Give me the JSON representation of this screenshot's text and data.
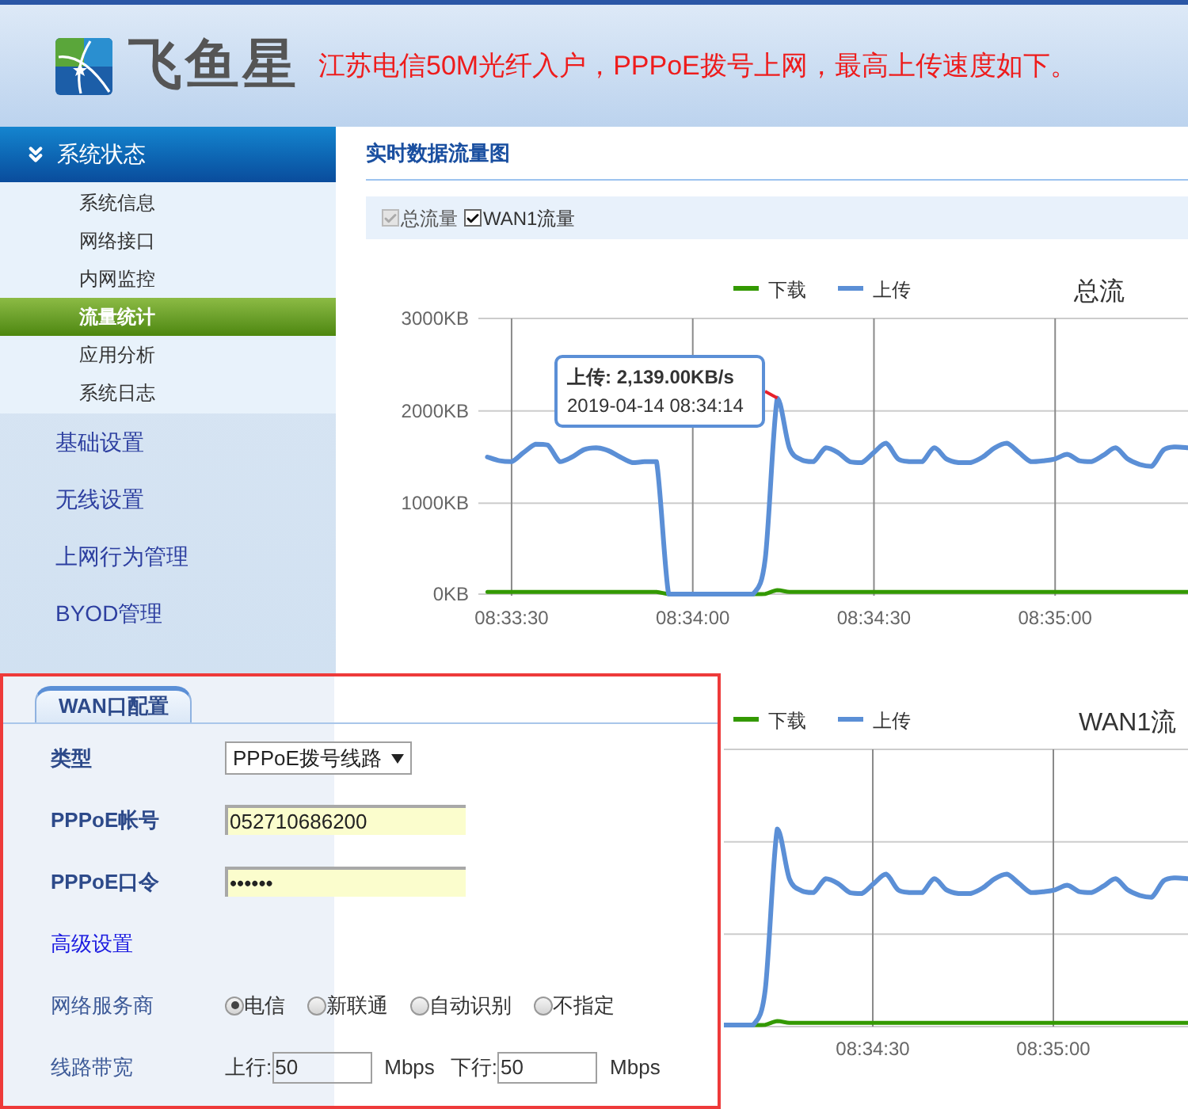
{
  "header": {
    "brand": "飞鱼星",
    "notice": "江苏电信50M光纤入户，PPPoE拨号上网，最高上传速度如下。"
  },
  "sidebar": {
    "sections": [
      {
        "label": "系统状态",
        "expanded": true,
        "children": [
          {
            "label": "系统信息",
            "selected": false
          },
          {
            "label": "网络接口",
            "selected": false
          },
          {
            "label": "内网监控",
            "selected": false
          },
          {
            "label": "流量统计",
            "selected": true
          },
          {
            "label": "应用分析",
            "selected": false
          },
          {
            "label": "系统日志",
            "selected": false
          }
        ]
      },
      {
        "label": "基础设置",
        "expanded": false
      },
      {
        "label": "无线设置",
        "expanded": false
      },
      {
        "label": "上网行为管理",
        "expanded": false
      },
      {
        "label": "BYOD管理",
        "expanded": false
      }
    ]
  },
  "main": {
    "title": "实时数据流量图",
    "filters": [
      {
        "label": "总流量",
        "checked": true,
        "disabled": true
      },
      {
        "label": "WAN1流量",
        "checked": true,
        "disabled": false
      }
    ],
    "charts": [
      {
        "title": "总流",
        "tooltip": {
          "value": "上传: 2,139.00KB/s",
          "time": "2019-04-14 08:34:14"
        },
        "chart_data": {
          "type": "line",
          "categories": [
            null,
            null,
            "08:33:30",
            null,
            null,
            null,
            null,
            null,
            null,
            null,
            null,
            null,
            null,
            null,
            null,
            null,
            null,
            "08:34:00",
            null,
            null,
            null,
            null,
            null,
            null,
            null,
            null,
            null,
            null,
            null,
            null,
            null,
            null,
            "08:34:30",
            null,
            null,
            null,
            null,
            null,
            null,
            null,
            null,
            null,
            null,
            null,
            null,
            null,
            null,
            "08:35:00",
            null,
            null,
            null,
            null,
            null,
            null,
            null,
            null,
            null,
            null,
            null
          ],
          "series": [
            {
              "name": "下载",
              "color": "#339900",
              "values": [
                40,
                40,
                40,
                40,
                40,
                40,
                40,
                40,
                40,
                40,
                40,
                40,
                40,
                40,
                40,
                0,
                0,
                0,
                0,
                0,
                0,
                0,
                0,
                20,
                60,
                40,
                40,
                40,
                40,
                40,
                40,
                40,
                40,
                40,
                40,
                40,
                40,
                40,
                40,
                40,
                40,
                40,
                40,
                40,
                40,
                40,
                40,
                40,
                40,
                40,
                40,
                40,
                40,
                40,
                40,
                40,
                40,
                40,
                40
              ]
            },
            {
              "name": "上传",
              "color": "#5b8fd6",
              "values": [
                1500,
                1460,
                1450,
                1550,
                1640,
                1630,
                1450,
                1500,
                1580,
                1600,
                1570,
                1500,
                1440,
                1450,
                1450,
                0,
                0,
                0,
                0,
                0,
                0,
                0,
                0,
                400,
                2139,
                1600,
                1470,
                1450,
                1600,
                1550,
                1450,
                1440,
                1550,
                1650,
                1480,
                1450,
                1450,
                1600,
                1480,
                1440,
                1440,
                1500,
                1600,
                1650,
                1550,
                1450,
                1460,
                1480,
                1530,
                1460,
                1450,
                1520,
                1600,
                1480,
                1420,
                1400,
                1580,
                1610,
                1600
              ]
            }
          ],
          "ylim": [
            0,
            3000
          ],
          "grid": true,
          "legend": "top",
          "yticks": [
            {
              "value": 0,
              "label": "0KB"
            },
            {
              "value": 1000,
              "label": "1000KB"
            },
            {
              "value": 2000,
              "label": "2000KB"
            },
            {
              "value": 3000,
              "label": "3000KB"
            }
          ]
        }
      },
      {
        "title": "WAN1流",
        "legend": [
          {
            "name": "下载",
            "color": "#339900"
          },
          {
            "name": "上传",
            "color": "#5b8fd6"
          }
        ],
        "x_labels": [
          "08:34:30",
          "08:35:00"
        ]
      }
    ]
  },
  "wan_panel": {
    "tab": "WAN口配置",
    "fields": [
      {
        "kind": "select",
        "label": "类型",
        "value": "PPPoE拨号线路"
      },
      {
        "kind": "text",
        "label": "PPPoE帐号",
        "value": "052710686200"
      },
      {
        "kind": "text",
        "label": "PPPoE口令",
        "value": "••••••"
      },
      {
        "kind": "link",
        "label": "高级设置"
      },
      {
        "kind": "radio",
        "label": "网络服务商",
        "options": [
          {
            "label": "电信",
            "selected": true
          },
          {
            "label": "新联通",
            "selected": false
          },
          {
            "label": "自动识别",
            "selected": false
          },
          {
            "label": "不指定",
            "selected": false
          }
        ]
      },
      {
        "kind": "bandwidth",
        "label": "线路带宽",
        "up_label": "上行:",
        "up_value": "50",
        "up_unit": "Mbps",
        "down_label": "下行:",
        "down_value": "50",
        "down_unit": "Mbps"
      }
    ]
  }
}
